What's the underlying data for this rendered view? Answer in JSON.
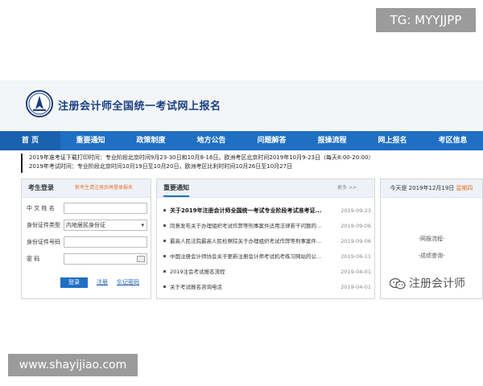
{
  "watermark_top": "TG: MYYJJPP",
  "watermark_bottom": "www.shayijiao.com",
  "wechat_watermark": "注册会计师",
  "header": {
    "title": "注册会计师全国统一考试网上报名"
  },
  "nav": [
    {
      "label": "首  页"
    },
    {
      "label": "重要通知"
    },
    {
      "label": "政策制度"
    },
    {
      "label": "地方公告"
    },
    {
      "label": "问题解答"
    },
    {
      "label": "报操流程"
    },
    {
      "label": "网上报名"
    },
    {
      "label": "考区信息"
    }
  ],
  "notice_bar": {
    "line1": "2019年准考证下载打印时间：专业阶段北京时间9月23-30日和10月8-16日。欧洲考区北京时间2019年10月9-23日（每天8:00-20:00）",
    "line2": "2019年考试时间：专业阶段北京时间10月19日至10月20日，欧洲考区比利时时间10月26日至10月27日"
  },
  "login": {
    "title": "考生登录",
    "hint": "新考生请注册后再登录报名",
    "fields": [
      {
        "label": "中  文  姓  名",
        "value": ""
      },
      {
        "label": "身份证件类型",
        "value": "内地居民身份证"
      },
      {
        "label": "身份证件号码",
        "value": ""
      },
      {
        "label": "密        码",
        "value": ""
      }
    ],
    "login_button": "登录",
    "register_link": "注册",
    "forgot_link": "忘记密码"
  },
  "notices": {
    "title": "重要通知",
    "more": "更多 >>",
    "items": [
      {
        "text": "关于2019年注册会计师全国统一考试专业阶段考试准考证...",
        "date": "2019-09-23"
      },
      {
        "text": "同意发布关于办理组织考试作弊等刑事案件适用法律若干问题的...",
        "date": "2019-09-06"
      },
      {
        "text": "最高人民法院最高人民检察院关于办理组织考试作弊等刑事案件...",
        "date": "2019-09-06"
      },
      {
        "text": "中国注册会计师协会关于更新注册会计师考试机考练习网站的公...",
        "date": "2019-06-11"
      },
      {
        "text": "2019注会考试报名流程",
        "date": "2019-04-01"
      },
      {
        "text": "关于考试报名咨询电话",
        "date": "2019-04-01"
      }
    ]
  },
  "right_panel": {
    "date_text": "今天是 2019年12月19日",
    "weekday": "星期四",
    "link1": "-网报流程-",
    "link2": "-成绩查询-"
  },
  "colors": {
    "nav_bg": "#1f6fc4",
    "title": "#1a3f82",
    "accent_orange": "#e8732a"
  }
}
